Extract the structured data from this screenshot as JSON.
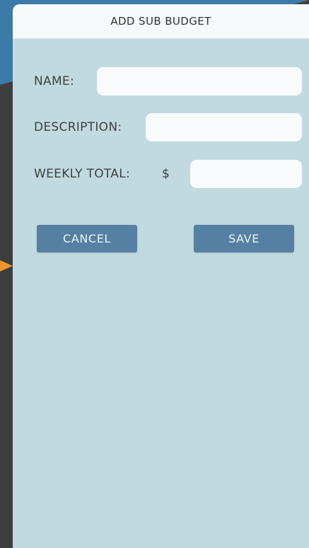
{
  "modal": {
    "title": "ADD SUB BUDGET"
  },
  "form": {
    "name_label": "NAME:",
    "name_value": "",
    "description_label": "DESCRIPTION:",
    "description_value": "",
    "weekly_total_label": "WEEKLY TOTAL:",
    "currency_symbol": "$",
    "weekly_total_value": ""
  },
  "actions": {
    "cancel_label": "CANCEL",
    "save_label": "SAVE"
  },
  "colors": {
    "modal_background": "#c1dadf",
    "header_background": "#f7fafb",
    "button_background": "#5580a3",
    "background_header": "#3c7ba8",
    "background_body": "#3c3e3e",
    "arrow_accent": "#f0962a"
  }
}
